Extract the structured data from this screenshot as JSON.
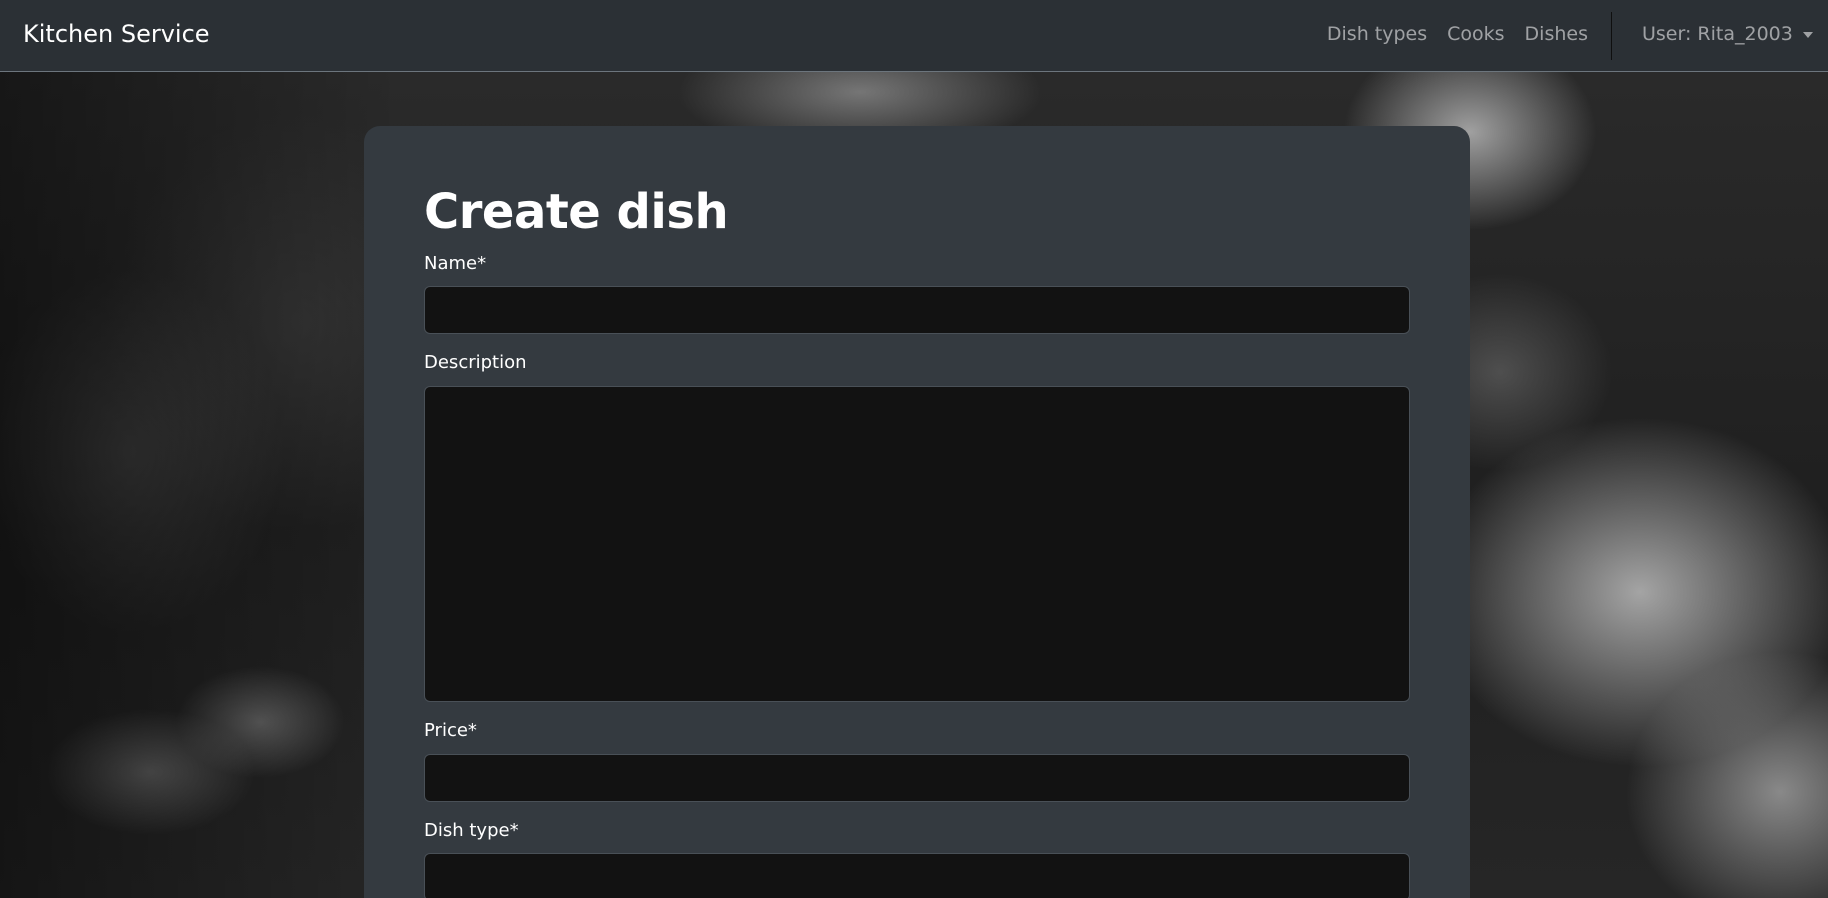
{
  "navbar": {
    "brand": "Kitchen Service",
    "links": [
      {
        "label": "Dish types"
      },
      {
        "label": "Cooks"
      },
      {
        "label": "Dishes"
      }
    ],
    "user_label": "User: Rita_2003"
  },
  "form": {
    "title": "Create dish",
    "fields": {
      "name": {
        "label": "Name*",
        "value": ""
      },
      "description": {
        "label": "Description",
        "value": ""
      },
      "price": {
        "label": "Price*",
        "value": ""
      },
      "dish_type": {
        "label": "Dish type*"
      }
    }
  }
}
